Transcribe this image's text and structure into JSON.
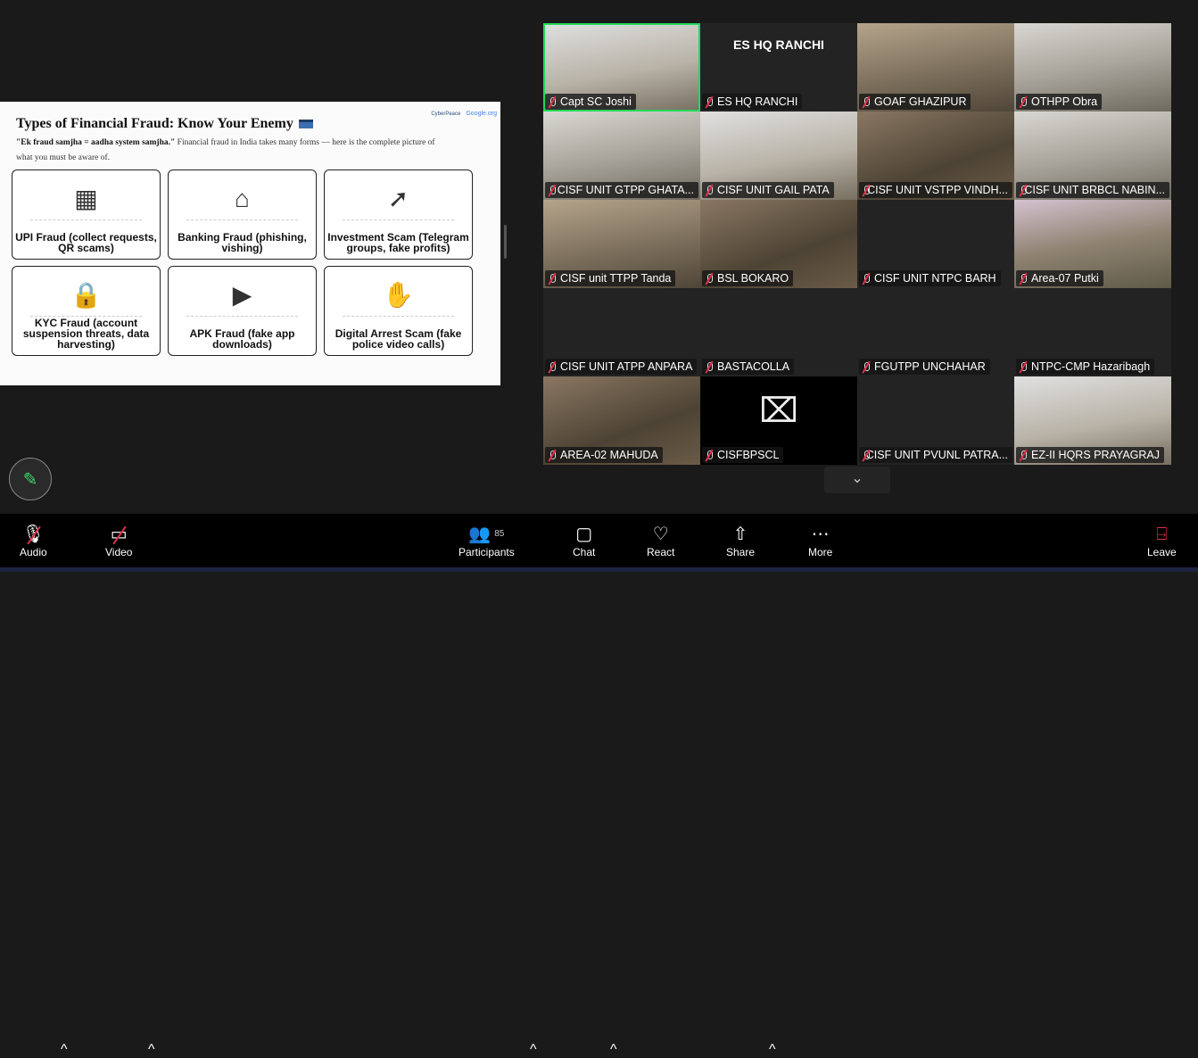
{
  "slide": {
    "title": "Types of Financial Fraud: Know Your Enemy",
    "subtitle_bold": "\"Ek fraud samjha = aadha system samjha.\"",
    "subtitle_rest": " Financial fraud in India takes many forms — here is the complete picture of what you must be aware of.",
    "logo_left": "CyberPeace",
    "logo_right": "Google.org",
    "cards": [
      {
        "label": "UPI Fraud (collect requests, QR scams)",
        "icon": "qr-phone-icon",
        "glyph": "▦"
      },
      {
        "label": "Banking Fraud (phishing, vishing)",
        "icon": "bank-phishing-icon",
        "glyph": "⌂"
      },
      {
        "label": "Investment Scam (Telegram groups, fake profits)",
        "icon": "telegram-chart-icon",
        "glyph": "➚"
      },
      {
        "label": "KYC Fraud (account suspension threats, data harvesting)",
        "icon": "id-lock-icon",
        "glyph": "🔒"
      },
      {
        "label": "APK Fraud (fake app downloads)",
        "icon": "phone-app-icon",
        "glyph": "▶"
      },
      {
        "label": "Digital Arrest Scam (fake police video calls)",
        "icon": "police-video-icon",
        "glyph": "✋"
      }
    ]
  },
  "tiles": [
    {
      "name": "Capt SC Joshi",
      "style": "v5",
      "active": true
    },
    {
      "name": "ES HQ RANCHI",
      "style": "",
      "big": "ES HQ RANCHI"
    },
    {
      "name": "GOAF GHAZIPUR",
      "style": "v3"
    },
    {
      "name": "OTHPP Obra",
      "style": "v2"
    },
    {
      "name": "CISF UNIT GTPP GHATA...",
      "style": "v2"
    },
    {
      "name": "CISF UNIT GAIL PATA",
      "style": "v5"
    },
    {
      "name": "CISF UNIT VSTPP VINDH...",
      "style": "v1"
    },
    {
      "name": "CISF UNIT BRBCL NABIN...",
      "style": "v2"
    },
    {
      "name": "CISF unit TTPP Tanda",
      "style": "v3"
    },
    {
      "name": "BSL BOKARO",
      "style": "v1"
    },
    {
      "name": "CISF UNIT NTPC BARH",
      "style": ""
    },
    {
      "name": "Area-07 Putki",
      "style": "v4"
    },
    {
      "name": "CISF UNIT ATPP ANPARA",
      "style": ""
    },
    {
      "name": "BASTACOLLA",
      "style": ""
    },
    {
      "name": "FGUTPP UNCHAHAR",
      "style": ""
    },
    {
      "name": "NTPC-CMP Hazaribagh",
      "style": ""
    },
    {
      "name": "AREA-02 MAHUDA",
      "style": "v1"
    },
    {
      "name": "CISFBPSCL",
      "style": "black",
      "camoff": true
    },
    {
      "name": "CISF UNIT PVUNL PATRA...",
      "style": ""
    },
    {
      "name": "EZ-II HQRS PRAYAGRAJ",
      "style": "v5"
    }
  ],
  "toolbar": {
    "audio": "Audio",
    "video": "Video",
    "participants": "Participants",
    "participant_count": "85",
    "chat": "Chat",
    "react": "React",
    "share": "Share",
    "more": "More",
    "leave": "Leave"
  },
  "colors": {
    "active_speaker": "#23d959",
    "muted": "#e02f4a"
  }
}
